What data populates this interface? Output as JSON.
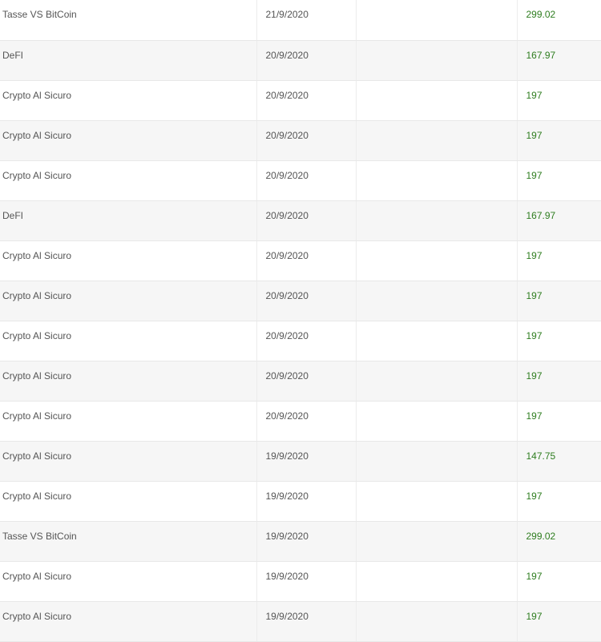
{
  "colors": {
    "amount_text": "#2e7d1f",
    "row_alt_background": "#f6f6f6",
    "text": "#555555"
  },
  "rows": [
    {
      "product": "Tasse VS BitCoin",
      "date": "21/9/2020",
      "extra": "",
      "amount": "299.02"
    },
    {
      "product": "DeFI",
      "date": "20/9/2020",
      "extra": "",
      "amount": "167.97"
    },
    {
      "product": "Crypto Al Sicuro",
      "date": "20/9/2020",
      "extra": "",
      "amount": "197"
    },
    {
      "product": "Crypto Al Sicuro",
      "date": "20/9/2020",
      "extra": "",
      "amount": "197"
    },
    {
      "product": "Crypto Al Sicuro",
      "date": "20/9/2020",
      "extra": "",
      "amount": "197"
    },
    {
      "product": "DeFI",
      "date": "20/9/2020",
      "extra": "",
      "amount": "167.97"
    },
    {
      "product": "Crypto Al Sicuro",
      "date": "20/9/2020",
      "extra": "",
      "amount": "197"
    },
    {
      "product": "Crypto Al Sicuro",
      "date": "20/9/2020",
      "extra": "",
      "amount": "197"
    },
    {
      "product": "Crypto Al Sicuro",
      "date": "20/9/2020",
      "extra": "",
      "amount": "197"
    },
    {
      "product": "Crypto Al Sicuro",
      "date": "20/9/2020",
      "extra": "",
      "amount": "197"
    },
    {
      "product": "Crypto Al Sicuro",
      "date": "20/9/2020",
      "extra": "",
      "amount": "197"
    },
    {
      "product": "Crypto Al Sicuro",
      "date": "19/9/2020",
      "extra": "",
      "amount": "147.75"
    },
    {
      "product": "Crypto Al Sicuro",
      "date": "19/9/2020",
      "extra": "",
      "amount": "197"
    },
    {
      "product": "Tasse VS BitCoin",
      "date": "19/9/2020",
      "extra": "",
      "amount": "299.02"
    },
    {
      "product": "Crypto Al Sicuro",
      "date": "19/9/2020",
      "extra": "",
      "amount": "197"
    },
    {
      "product": "Crypto Al Sicuro",
      "date": "19/9/2020",
      "extra": "",
      "amount": "197"
    }
  ]
}
